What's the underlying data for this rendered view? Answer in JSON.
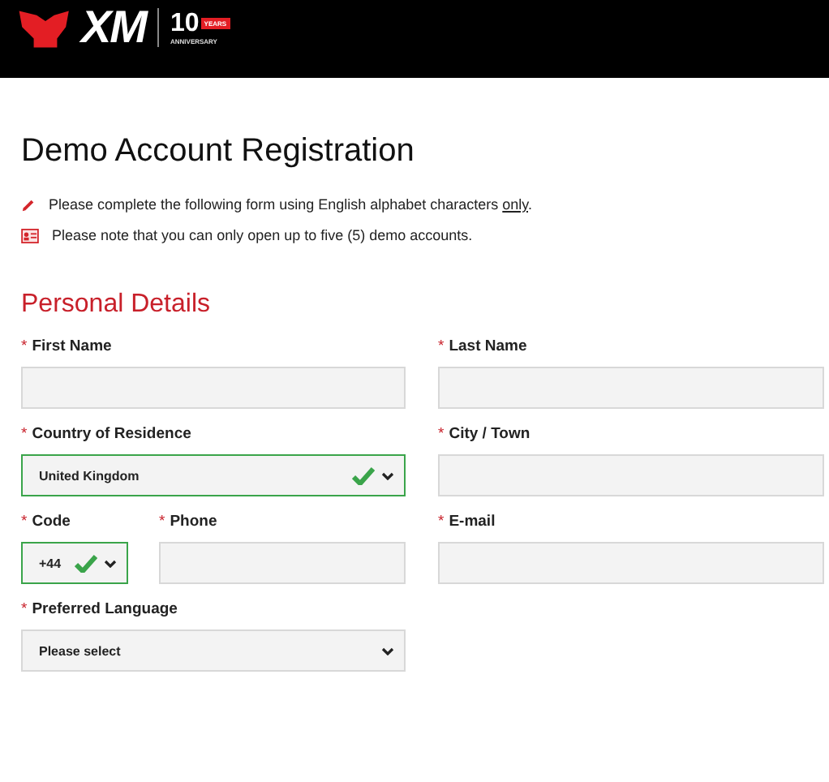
{
  "header": {
    "logo": {
      "brand": "XM",
      "anniversary_number": "10",
      "years": "YEARS",
      "anniversary": "ANNIVERSARY"
    }
  },
  "title": "Demo Account Registration",
  "notes": [
    {
      "kind": "pencil",
      "text": "Please complete the following form using English alphabet characters ",
      "link": "only",
      "tail": "."
    },
    {
      "kind": "card",
      "text": "Please note that you can only open up to five (5) demo accounts."
    }
  ],
  "section": "Personal Details",
  "rows": [
    [
      {
        "marker": "*",
        "label": "First Name",
        "kind": "text",
        "valid": false
      },
      {
        "marker": "*",
        "label": "Last Name",
        "kind": "text",
        "valid": false
      }
    ],
    [
      {
        "marker": "*",
        "label": "Country of Residence",
        "kind": "select",
        "value": "United Kingdom",
        "valid": true
      },
      {
        "marker": "*",
        "label": "City / Town",
        "kind": "text",
        "valid": false
      }
    ],
    [
      {
        "kind": "group",
        "fields": [
          {
            "marker": "*",
            "label": "Code",
            "kind": "select",
            "value": "+44",
            "valid": true
          },
          {
            "marker": "*",
            "label": "Phone",
            "kind": "text",
            "valid": false
          }
        ]
      },
      {
        "marker": "*",
        "label": "E-mail",
        "kind": "text",
        "valid": false
      }
    ],
    [
      {
        "marker": "*",
        "label": "Preferred Language",
        "kind": "select",
        "value": "Please select",
        "valid": false
      }
    ]
  ]
}
